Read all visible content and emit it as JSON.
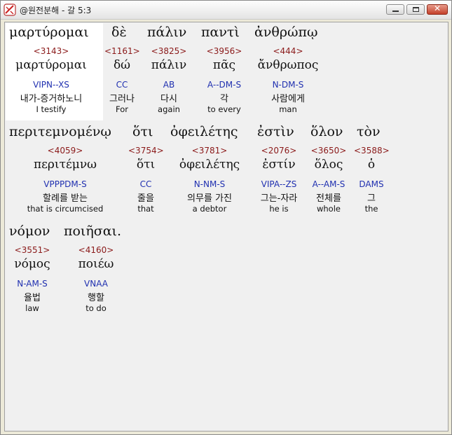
{
  "window": {
    "title": "@원전분해 - 갈 5:3"
  },
  "rows": [
    {
      "words": [
        {
          "greek": "μαρτύρομαι",
          "strong": "<3143>",
          "lemma": "μαρτύρομαι",
          "parse": "VIPN--XS",
          "korean": "내가-증거하노니",
          "english": "I testify"
        },
        {
          "greek": "δὲ",
          "strong": "<1161>",
          "lemma": "δώ",
          "parse": "CC",
          "korean": "그러나",
          "english": "For"
        },
        {
          "greek": "πάλιν",
          "strong": "<3825>",
          "lemma": "πάλιν",
          "parse": "AB",
          "korean": "다시",
          "english": "again"
        },
        {
          "greek": "παντὶ",
          "strong": "<3956>",
          "lemma": "πᾶς",
          "parse": "A--DM-S",
          "korean": "각",
          "english": "to every"
        },
        {
          "greek": "ἀνθρώπῳ",
          "strong": "<444>",
          "lemma": "ἄνθρωπος",
          "parse": "N-DM-S",
          "korean": "사람에게",
          "english": "man"
        }
      ]
    },
    {
      "words": [
        {
          "greek": "περιτεμνομένῳ",
          "strong": "<4059>",
          "lemma": "περιτέμνω",
          "parse": "VPPPDM-S",
          "korean": "할례를 받는",
          "english": "that is circumcised"
        },
        {
          "greek": "ὅτι",
          "strong": "<3754>",
          "lemma": "ὅτι",
          "parse": "CC",
          "korean": "줄을",
          "english": "that"
        },
        {
          "greek": "ὀφειλέτης",
          "strong": "<3781>",
          "lemma": "ὀφειλέτης",
          "parse": "N-NM-S",
          "korean": "의무를 가진",
          "english": "a debtor"
        },
        {
          "greek": "ἐστὶν",
          "strong": "<2076>",
          "lemma": "ἐστίν",
          "parse": "VIPA--ZS",
          "korean": "그는-자라",
          "english": "he is"
        },
        {
          "greek": "ὅλον",
          "strong": "<3650>",
          "lemma": "ὅλος",
          "parse": "A--AM-S",
          "korean": "전체를",
          "english": "whole"
        },
        {
          "greek": "τὸν",
          "strong": "<3588>",
          "lemma": "ὁ",
          "parse": "DAMS",
          "korean": "그",
          "english": "the"
        }
      ]
    },
    {
      "words": [
        {
          "greek": "νόμον",
          "strong": "<3551>",
          "lemma": "νόμος",
          "parse": "N-AM-S",
          "korean": "율법",
          "english": "law"
        },
        {
          "greek": "ποιῆσαι.",
          "strong": "<4160>",
          "lemma": "ποιέω",
          "parse": "VNAA",
          "korean": "행할",
          "english": "to do"
        }
      ]
    }
  ]
}
